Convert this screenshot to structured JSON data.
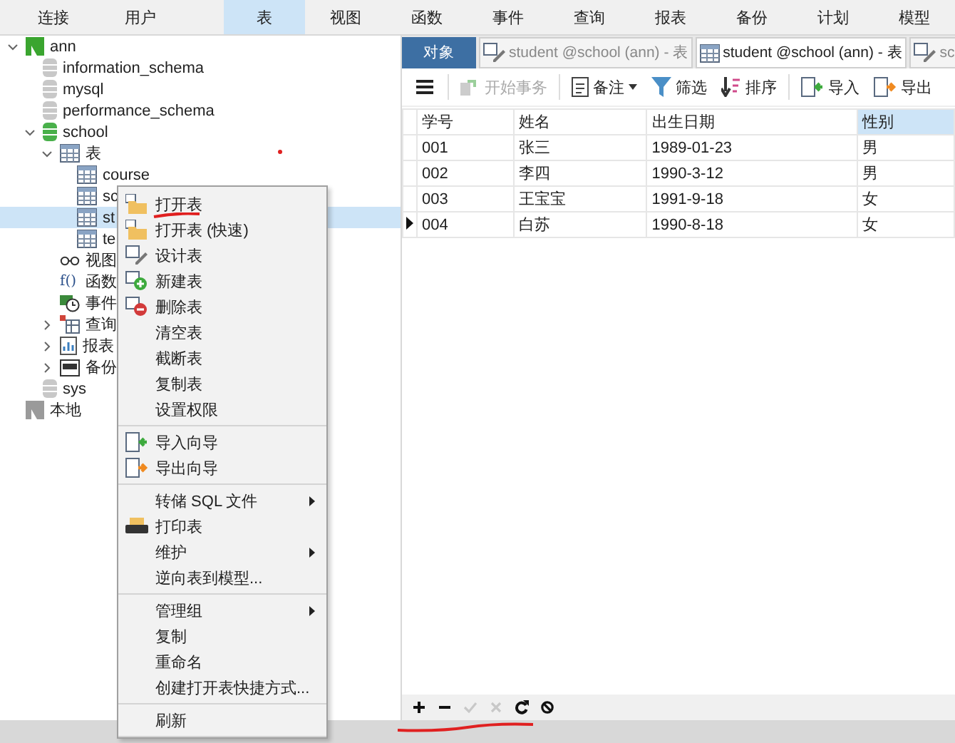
{
  "menu_bar": [
    {
      "label": "连接",
      "selected": false
    },
    {
      "label": "用户",
      "selected": false
    },
    {
      "label": "表",
      "selected": true
    },
    {
      "label": "视图",
      "selected": false
    },
    {
      "label": "函数",
      "selected": false
    },
    {
      "label": "事件",
      "selected": false
    },
    {
      "label": "查询",
      "selected": false
    },
    {
      "label": "报表",
      "selected": false
    },
    {
      "label": "备份",
      "selected": false
    },
    {
      "label": "计划",
      "selected": false
    },
    {
      "label": "模型",
      "selected": false
    }
  ],
  "tree": [
    {
      "label": "ann",
      "kind": "connection",
      "expanded": true,
      "selected": false,
      "children": [
        {
          "label": "information_schema",
          "kind": "database",
          "selected": false
        },
        {
          "label": "mysql",
          "kind": "database",
          "selected": false
        },
        {
          "label": "performance_schema",
          "kind": "database",
          "selected": false
        },
        {
          "label": "school",
          "kind": "database-open",
          "expanded": true,
          "selected": false,
          "children": [
            {
              "label": "表",
              "kind": "table",
              "expanded": true,
              "selected": false,
              "children": [
                {
                  "label": "course",
                  "kind": "table",
                  "selected": false
                },
                {
                  "label": "sc",
                  "kind": "table",
                  "selected": false
                },
                {
                  "label": "st",
                  "kind": "table",
                  "selected": true
                },
                {
                  "label": "te",
                  "kind": "table",
                  "selected": false
                }
              ]
            },
            {
              "label": "视图",
              "kind": "view",
              "selected": false
            },
            {
              "label": "函数",
              "kind": "function",
              "glyph": "f()",
              "selected": false
            },
            {
              "label": "事件",
              "kind": "event",
              "selected": false
            },
            {
              "label": "查询",
              "kind": "query",
              "expanded": false,
              "selected": false
            },
            {
              "label": "报表",
              "kind": "report",
              "expanded": false,
              "selected": false
            },
            {
              "label": "备份",
              "kind": "backup",
              "expanded": false,
              "selected": false
            }
          ]
        },
        {
          "label": "sys",
          "kind": "database",
          "selected": false
        }
      ]
    },
    {
      "label": "本地",
      "kind": "connection-off",
      "selected": false
    }
  ],
  "tabs": [
    {
      "label": "对象",
      "selected": false,
      "kind": "objects"
    },
    {
      "label": "student @school (ann) - 表",
      "selected": false,
      "kind": "design"
    },
    {
      "label": "student @school (ann) - 表",
      "selected": true,
      "kind": "table"
    },
    {
      "label": "sc",
      "selected": false,
      "kind": "design"
    }
  ],
  "toolbar": [
    {
      "label": "开始事务",
      "kind": "transaction",
      "disabled": true,
      "dropdown": false
    },
    {
      "label": "备注",
      "kind": "note",
      "disabled": false,
      "dropdown": true
    },
    {
      "label": "筛选",
      "kind": "filter",
      "disabled": false,
      "dropdown": false
    },
    {
      "label": "排序",
      "kind": "sort",
      "disabled": false,
      "dropdown": false
    },
    {
      "label": "导入",
      "kind": "import",
      "disabled": false,
      "dropdown": false
    },
    {
      "label": "导出",
      "kind": "export",
      "disabled": false,
      "dropdown": false
    }
  ],
  "table": {
    "columns": [
      {
        "label": "学号",
        "selected": false
      },
      {
        "label": "姓名",
        "selected": false
      },
      {
        "label": "出生日期",
        "selected": false
      },
      {
        "label": "性别",
        "selected": true
      }
    ],
    "rows": [
      {
        "cells": [
          "001",
          "张三",
          "1989-01-23",
          "男"
        ],
        "current": false
      },
      {
        "cells": [
          "002",
          "李四",
          "1990-3-12",
          "男"
        ],
        "current": false
      },
      {
        "cells": [
          "003",
          "王宝宝",
          "1991-9-18",
          "女"
        ],
        "current": false
      },
      {
        "cells": [
          "004",
          "白苏",
          "1990-8-18",
          "女"
        ],
        "current": true
      }
    ]
  },
  "bottom_toolbar": [
    {
      "kind": "add",
      "disabled": false
    },
    {
      "kind": "remove",
      "disabled": false
    },
    {
      "kind": "apply",
      "disabled": true
    },
    {
      "kind": "discard",
      "disabled": true
    },
    {
      "kind": "refresh",
      "disabled": false
    },
    {
      "kind": "stop",
      "disabled": false
    }
  ],
  "context_menu": [
    [
      {
        "label": "打开表",
        "kind": "folder",
        "submenu": false
      },
      {
        "label": "打开表 (快速)",
        "kind": "folder",
        "submenu": false
      },
      {
        "label": "设计表",
        "kind": "design",
        "submenu": false
      },
      {
        "label": "新建表",
        "kind": "add",
        "submenu": false
      },
      {
        "label": "删除表",
        "kind": "delete",
        "submenu": false
      },
      {
        "label": "清空表",
        "kind": "plain",
        "submenu": false
      },
      {
        "label": "截断表",
        "kind": "plain",
        "submenu": false
      },
      {
        "label": "复制表",
        "kind": "plain",
        "submenu": false
      },
      {
        "label": "设置权限",
        "kind": "plain",
        "submenu": false
      }
    ],
    [
      {
        "label": "导入向导",
        "kind": "import",
        "submenu": false
      },
      {
        "label": "导出向导",
        "kind": "export",
        "submenu": false
      }
    ],
    [
      {
        "label": "转储 SQL 文件",
        "kind": "plain",
        "submenu": true
      },
      {
        "label": "打印表",
        "kind": "print",
        "submenu": false
      },
      {
        "label": "维护",
        "kind": "plain",
        "submenu": true
      },
      {
        "label": "逆向表到模型...",
        "kind": "plain",
        "submenu": false
      }
    ],
    [
      {
        "label": "管理组",
        "kind": "plain",
        "submenu": true
      },
      {
        "label": "复制",
        "kind": "plain",
        "submenu": false
      },
      {
        "label": "重命名",
        "kind": "plain",
        "submenu": false
      },
      {
        "label": "创建打开表快捷方式...",
        "kind": "plain",
        "submenu": false
      }
    ],
    [
      {
        "label": "刷新",
        "kind": "plain",
        "submenu": false
      }
    ]
  ]
}
